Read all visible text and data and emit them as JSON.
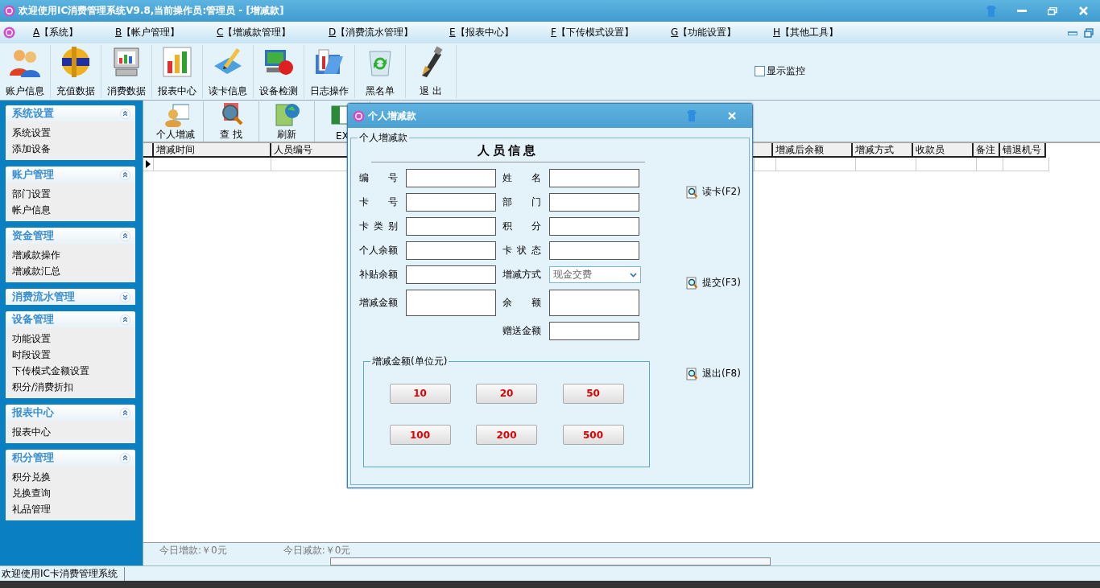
{
  "window": {
    "title": "欢迎使用IC消费管理系统V9.8,当前操作员:管理员 - [增减款]"
  },
  "menu": [
    {
      "key": "A",
      "label": "【系统】"
    },
    {
      "key": "B",
      "label": "【帐户管理】"
    },
    {
      "key": "C",
      "label": "【增减款管理】"
    },
    {
      "key": "D",
      "label": "【消费流水管理】"
    },
    {
      "key": "E",
      "label": "【报表中心】"
    },
    {
      "key": "F",
      "label": "【下传模式设置】"
    },
    {
      "key": "G",
      "label": "【功能设置】"
    },
    {
      "key": "H",
      "label": "【其他工具】"
    }
  ],
  "toolbar": [
    {
      "label": "账户信息"
    },
    {
      "label": "充值数据"
    },
    {
      "label": "消费数据"
    },
    {
      "label": "报表中心"
    },
    {
      "label": "读卡信息"
    },
    {
      "label": "设备检测"
    },
    {
      "label": "日志操作"
    },
    {
      "label": "黑名单"
    },
    {
      "label": "退 出"
    }
  ],
  "monitor_checkbox": {
    "label": "显示监控",
    "checked": false
  },
  "sidebar": [
    {
      "title": "系统设置",
      "expanded": true,
      "items": [
        "系统设置",
        "添加设备"
      ]
    },
    {
      "title": "账户管理",
      "expanded": true,
      "items": [
        "部门设置",
        "帐户信息"
      ]
    },
    {
      "title": "资金管理",
      "expanded": true,
      "items": [
        "增减款操作",
        "增减款汇总"
      ]
    },
    {
      "title": "消费流水管理",
      "expanded": false
    },
    {
      "title": "设备管理",
      "expanded": true,
      "items": [
        "功能设置",
        "时段设置",
        "下传模式金额设置",
        "积分/消费折扣"
      ]
    },
    {
      "title": "报表中心",
      "expanded": true,
      "items": [
        "报表中心"
      ]
    },
    {
      "title": "积分管理",
      "expanded": true,
      "items": [
        "积分兑换",
        "兑换查询",
        "礼品管理"
      ]
    }
  ],
  "sub_toolbar": [
    {
      "label": "个人增减"
    },
    {
      "label": "查 找"
    },
    {
      "label": "刷新"
    },
    {
      "label": "EX"
    }
  ],
  "table": {
    "columns": [
      "增减时间",
      "人员编号",
      "增减后余额",
      "增减方式",
      "收款员",
      "备注",
      "错退机号"
    ]
  },
  "summary": [
    "今日增款:￥0元",
    "今日减款:￥0元"
  ],
  "status_bar": "欢迎使用IC卡消费管理系统",
  "dialog": {
    "title": "个人增减款",
    "group_title": "个人增减款",
    "heading": "人员信息",
    "left_fields": [
      {
        "label": "编号",
        "kind": "text"
      },
      {
        "label": "卡号",
        "kind": "text"
      },
      {
        "label": "卡类别",
        "kind": "text"
      },
      {
        "label": "个人余额",
        "kind": "text"
      },
      {
        "label": "补贴余额",
        "kind": "text"
      },
      {
        "label": "增减金额",
        "kind": "tall"
      }
    ],
    "right_fields": [
      {
        "label": "姓名",
        "kind": "text"
      },
      {
        "label": "部门",
        "kind": "text"
      },
      {
        "label": "积分",
        "kind": "text"
      },
      {
        "label": "卡状态",
        "kind": "text"
      },
      {
        "label": "增减方式",
        "kind": "select",
        "value": "现金交费"
      },
      {
        "label": "余额",
        "kind": "tall"
      },
      {
        "label": "赠送金额",
        "kind": "text"
      }
    ],
    "actions": [
      "读卡(F2)",
      "提交(F3)",
      "退出(F8)"
    ],
    "amount_group": {
      "title": "增减金额(单位元)",
      "buttons": [
        "10",
        "20",
        "50",
        "100",
        "200",
        "500"
      ]
    }
  }
}
